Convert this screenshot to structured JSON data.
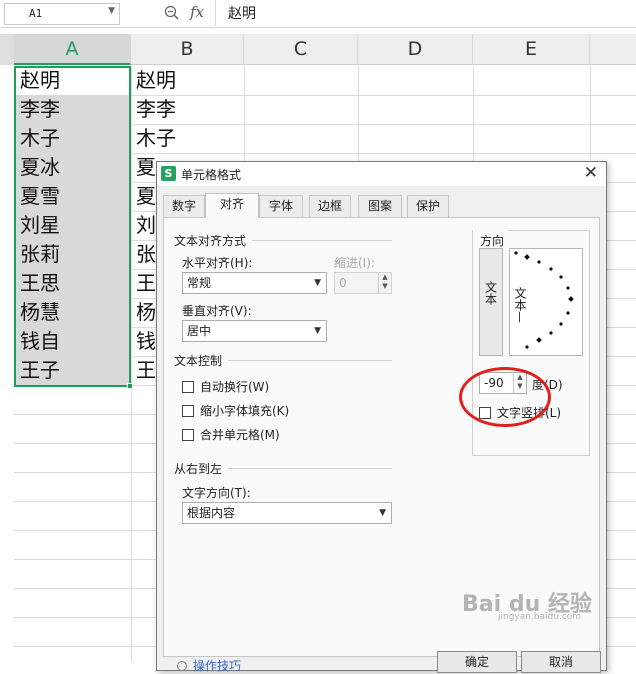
{
  "formula_bar": {
    "name_box": "A1",
    "fx": "fx",
    "content": "赵明"
  },
  "columns": [
    "A",
    "B",
    "C",
    "D",
    "E"
  ],
  "col_a": [
    "赵明",
    "李李",
    "木子",
    "夏冰",
    "夏雪",
    "刘星",
    "张莉",
    "王思",
    "杨慧",
    "钱自",
    "王子"
  ],
  "col_b": [
    "赵明",
    "李李",
    "木子",
    "夏",
    "夏",
    "刘",
    "张",
    "王",
    "杨",
    "钱",
    "王"
  ],
  "dialog": {
    "title": "单元格格式",
    "close": "✕",
    "tabs": [
      "数字",
      "对齐",
      "字体",
      "边框",
      "图案",
      "保护"
    ],
    "active_tab": "对齐",
    "text_alignment": {
      "group_title": "文本对齐方式",
      "horizontal_label": "水平对齐(H):",
      "horizontal_value": "常规",
      "indent_label": "缩进(I):",
      "indent_value": "0",
      "vertical_label": "垂直对齐(V):",
      "vertical_value": "居中"
    },
    "text_control": {
      "group_title": "文本控制",
      "wrap": "自动换行(W)",
      "shrink": "缩小字体填充(K)",
      "merge": "合并单元格(M)"
    },
    "rtl": {
      "group_title": "从右到左",
      "direction_label": "文字方向(T):",
      "direction_value": "根据内容"
    },
    "orientation": {
      "group_title": "方向",
      "vertical_button": "文本",
      "dial_text": "文本—",
      "degrees_value": "-90",
      "degrees_label": "度(D)",
      "vertical_text_label": "文字竖排(L)"
    },
    "tips": "操作技巧",
    "ok": "确定",
    "cancel": "取消"
  },
  "watermark": {
    "main": "Bai du 经验",
    "sub": "jingyan.baidu.com"
  }
}
